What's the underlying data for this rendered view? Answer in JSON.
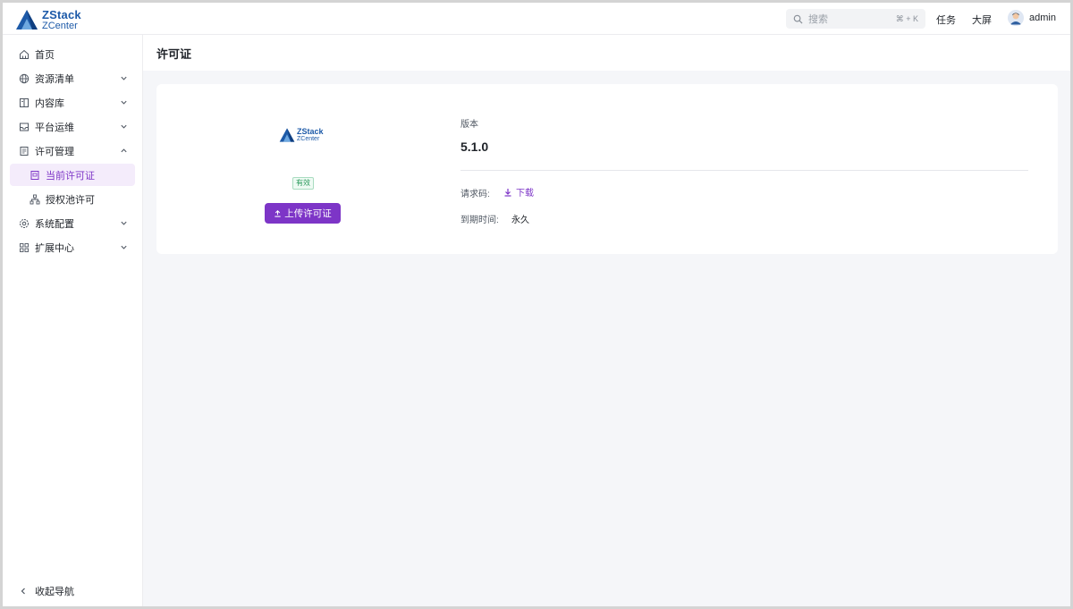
{
  "app": {
    "logo_line1": "ZStack",
    "logo_line2": "ZCenter"
  },
  "header": {
    "search_placeholder": "搜索",
    "search_shortcut": "⌘ + K",
    "tasks_label": "任务",
    "bigscreen_label": "大屏",
    "username": "admin"
  },
  "sidebar": {
    "items": [
      {
        "label": "首页",
        "icon": "home-icon"
      },
      {
        "label": "资源清单",
        "icon": "globe-icon"
      },
      {
        "label": "内容库",
        "icon": "book-icon"
      },
      {
        "label": "平台运维",
        "icon": "inbox-icon"
      },
      {
        "label": "许可管理",
        "icon": "license-icon"
      },
      {
        "label": "当前许可证",
        "icon": "document-icon"
      },
      {
        "label": "授权池许可",
        "icon": "network-icon"
      },
      {
        "label": "系统配置",
        "icon": "gear-icon"
      },
      {
        "label": "扩展中心",
        "icon": "grid-icon"
      }
    ],
    "collapse_label": "收起导航"
  },
  "page": {
    "title": "许可证"
  },
  "license": {
    "logo_line1": "ZStack",
    "logo_line2": "ZCenter",
    "status_badge": "有效",
    "upload_button": "上传许可证",
    "version_label": "版本",
    "version_value": "5.1.0",
    "request_code_label": "请求码:",
    "download_label": "下载",
    "expiry_label": "到期时间:",
    "expiry_value": "永久"
  },
  "colors": {
    "accent": "#7d35c7",
    "brand": "#1d5aa8",
    "valid": "#2b9a5c"
  }
}
